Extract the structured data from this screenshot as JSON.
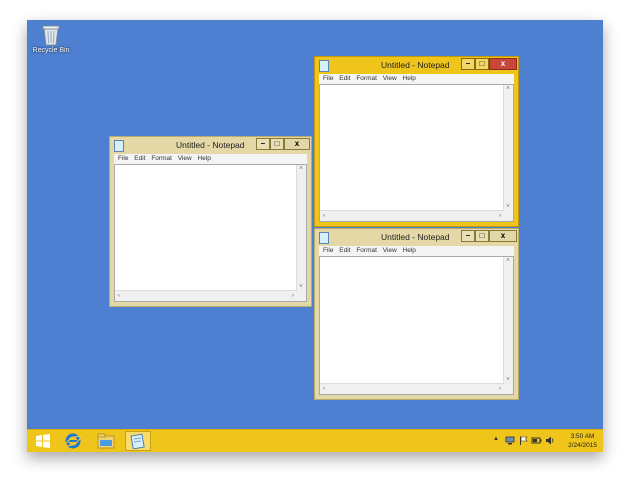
{
  "desktop": {
    "background_color": "#4e7fd0",
    "icons": [
      {
        "label": "Recycle Bin",
        "icon": "recycle-bin-icon"
      }
    ]
  },
  "windows": [
    {
      "id": "left",
      "title": "Untitled - Notepad",
      "active": false,
      "controls": {
        "minimize": "–",
        "maximize": "□",
        "close": "x"
      },
      "menu": [
        "File",
        "Edit",
        "Format",
        "View",
        "Help"
      ]
    },
    {
      "id": "top-right",
      "title": "Untitled - Notepad",
      "active": true,
      "controls": {
        "minimize": "–",
        "maximize": "□",
        "close": "x"
      },
      "menu": [
        "File",
        "Edit",
        "Format",
        "View",
        "Help"
      ]
    },
    {
      "id": "bottom-right",
      "title": "Untitled - Notepad",
      "active": false,
      "controls": {
        "minimize": "–",
        "maximize": "□",
        "close": "x"
      },
      "menu": [
        "File",
        "Edit",
        "Format",
        "View",
        "Help"
      ]
    }
  ],
  "taskbar": {
    "color": "#efc41b",
    "start_icon": "windows-start-icon",
    "pinned": [
      {
        "icon": "internet-explorer-icon"
      },
      {
        "icon": "file-explorer-icon"
      },
      {
        "icon": "notepad-icon",
        "active": true
      }
    ],
    "tray": {
      "overflow_arrow": "▲",
      "icons": [
        "network-icon",
        "flag-icon",
        "power-icon",
        "volume-icon"
      ]
    },
    "clock": {
      "time": "3:50 AM",
      "date": "2/24/2015"
    }
  },
  "colors": {
    "active_frame": "#efc41b",
    "inactive_frame": "#e3d8a6",
    "close_active": "#c7473a"
  }
}
